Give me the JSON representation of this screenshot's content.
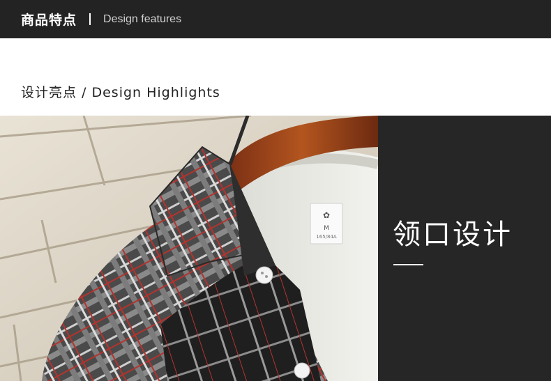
{
  "header": {
    "title_cn": "商品特点",
    "title_en": "Design features"
  },
  "section": {
    "title": "设计亮点 / Design Highlights"
  },
  "feature": {
    "title": "领口设计"
  },
  "photo": {
    "label_size": "M",
    "label_code": "165/84A"
  }
}
